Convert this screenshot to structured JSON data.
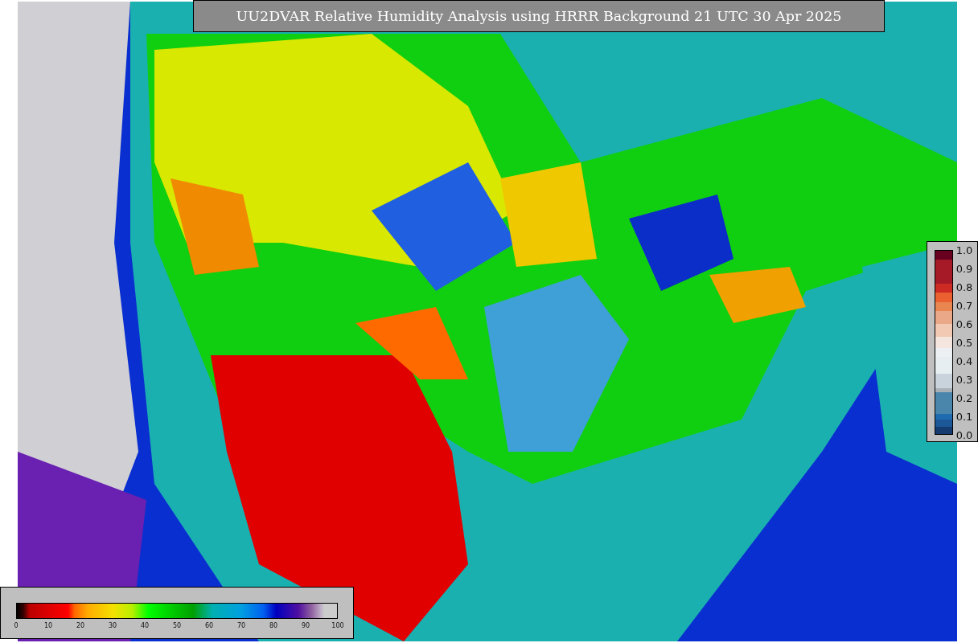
{
  "title": "UU2DVAR Relative Humidity Analysis using HRRR Background 21 UTC 30 Apr 2025",
  "observation_colorbar": {
    "ticks": [
      "1.0",
      "0.9",
      "0.8",
      "0.7",
      "0.6",
      "0.5",
      "0.4",
      "0.3",
      "0.2",
      "0.1",
      "0.0"
    ]
  },
  "humidity_colorbar": {
    "ticks": [
      "0",
      "10",
      "20",
      "30",
      "40",
      "50",
      "60",
      "70",
      "80",
      "90",
      "100"
    ]
  }
}
